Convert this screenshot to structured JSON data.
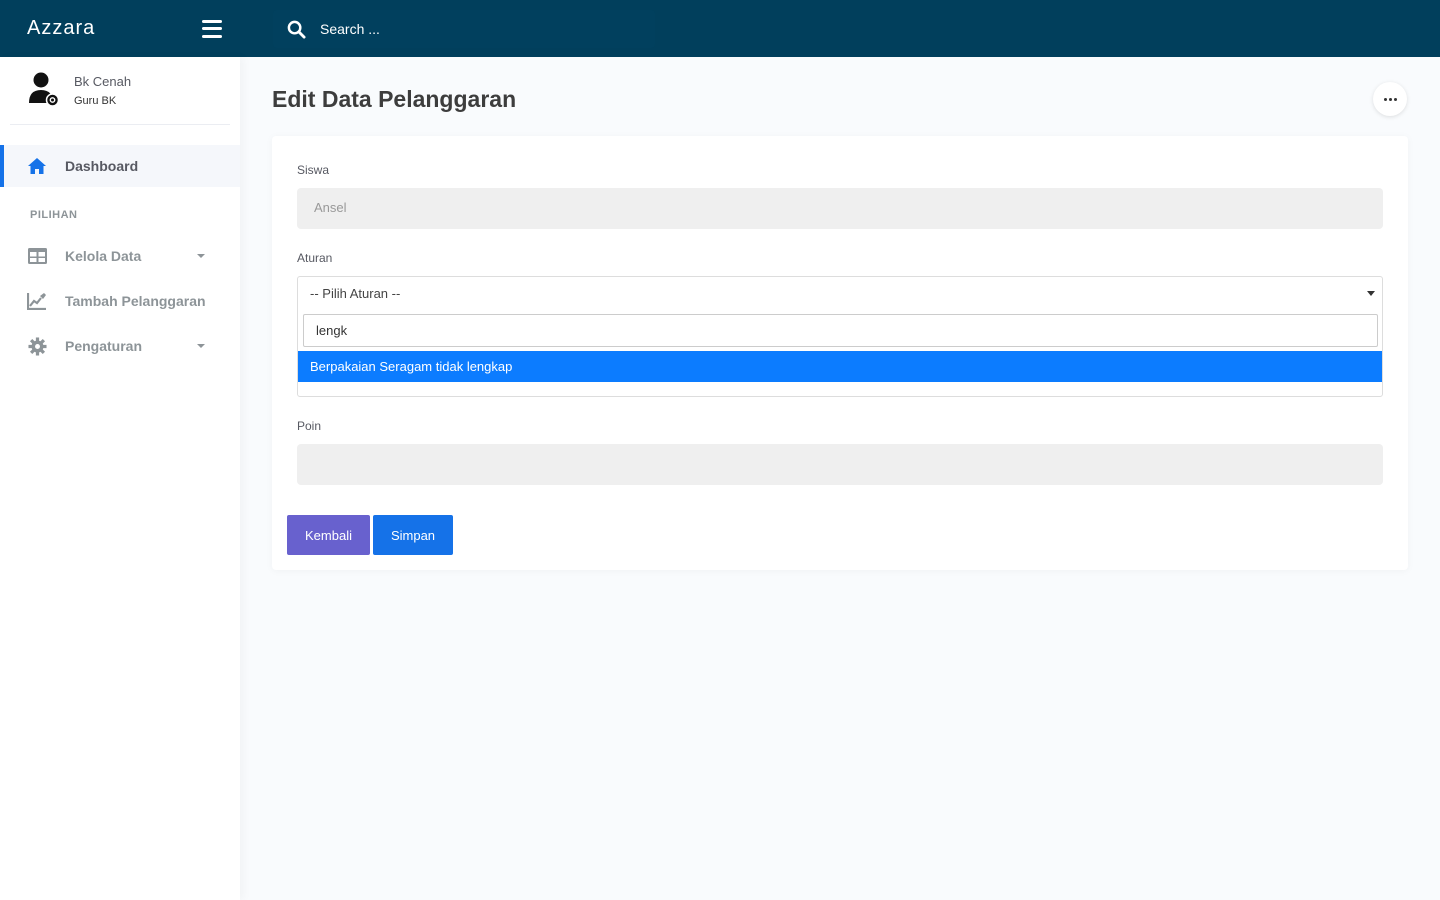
{
  "app": {
    "brand": "Azzara"
  },
  "header": {
    "search_placeholder": "Search ..."
  },
  "user": {
    "name": "Bk Cenah",
    "role": "Guru BK"
  },
  "sidebar": {
    "items": [
      {
        "label": "Dashboard",
        "icon": "home-icon",
        "active": true
      },
      {
        "label": "Kelola Data",
        "icon": "table-icon",
        "has_caret": true
      },
      {
        "label": "Tambah Pelanggaran",
        "icon": "edit-chart-icon"
      },
      {
        "label": "Pengaturan",
        "icon": "gear-icon",
        "has_caret": true
      }
    ],
    "section_label": "PILIHAN"
  },
  "page": {
    "title": "Edit Data Pelanggaran"
  },
  "form": {
    "siswa": {
      "label": "Siswa",
      "value": "Ansel"
    },
    "aturan": {
      "label": "Aturan",
      "selected": "-- Pilih Aturan --",
      "search_value": "lengk",
      "options": [
        "Berpakaian Seragam tidak lengkap"
      ]
    },
    "poin": {
      "label": "Poin",
      "value": ""
    },
    "buttons": {
      "back": "Kembali",
      "save": "Simpan"
    }
  },
  "colors": {
    "header": "#013f5c",
    "primary": "#1572e8",
    "secondary": "#6861ce",
    "option_highlight": "#0c7cff"
  }
}
